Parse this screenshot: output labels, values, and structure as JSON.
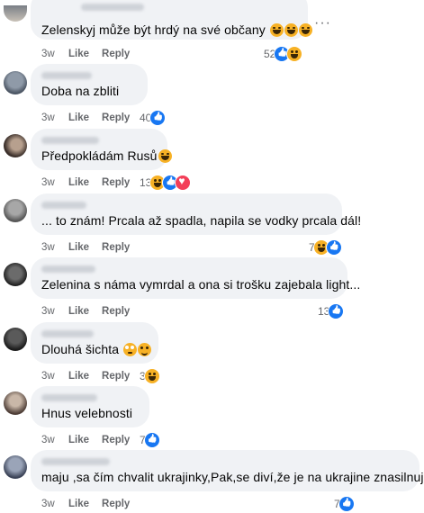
{
  "more_label": "···",
  "comments": [
    {
      "text": "Zelenskyj může být hrdý na své občany",
      "emojis": [
        "laugh",
        "laugh",
        "laugh"
      ],
      "time": "3w",
      "like": "Like",
      "reply": "Reply",
      "count": "52",
      "reactions": [
        "like",
        "haha"
      ]
    },
    {
      "text": "Doba na zbliti",
      "emojis": [],
      "time": "3w",
      "like": "Like",
      "reply": "Reply",
      "count": "40",
      "reactions": [
        "like"
      ]
    },
    {
      "text": "Předpokládám Rusů",
      "emojis": [
        "laugh"
      ],
      "time": "3w",
      "like": "Like",
      "reply": "Reply",
      "count": "13",
      "reactions": [
        "haha",
        "like",
        "love"
      ]
    },
    {
      "text": "... to znám! Prcala až spadla, napila se vodky prcala dál!",
      "emojis": [],
      "time": "3w",
      "like": "Like",
      "reply": "Reply",
      "count": "7",
      "reactions": [
        "haha",
        "like"
      ]
    },
    {
      "text": "Zelenina s náma vymrdal a ona si trošku zajebala light...",
      "emojis": [],
      "time": "3w",
      "like": "Like",
      "reply": "Reply",
      "count": "13",
      "reactions": [
        "like"
      ]
    },
    {
      "text": "Dlouhá šichta",
      "emojis": [
        "roll",
        "grin"
      ],
      "time": "3w",
      "like": "Like",
      "reply": "Reply",
      "count": "3",
      "reactions": [
        "haha"
      ]
    },
    {
      "text": "Hnus velebnosti",
      "emojis": [],
      "time": "3w",
      "like": "Like",
      "reply": "Reply",
      "count": "7",
      "reactions": [
        "like"
      ]
    },
    {
      "text": "maju ,sa čím chvalit ukrajinky,Pak,se diví,že je na ukrajine znasilnujou",
      "emojis": [],
      "time": "3w",
      "like": "Like",
      "reply": "Reply",
      "count": "7",
      "reactions": [
        "like"
      ]
    }
  ],
  "colors": {
    "bubble": "#f0f2f5",
    "like": "#1877f2",
    "haha": "#f7b125",
    "love": "#f33e58",
    "meta": "#65676b"
  }
}
